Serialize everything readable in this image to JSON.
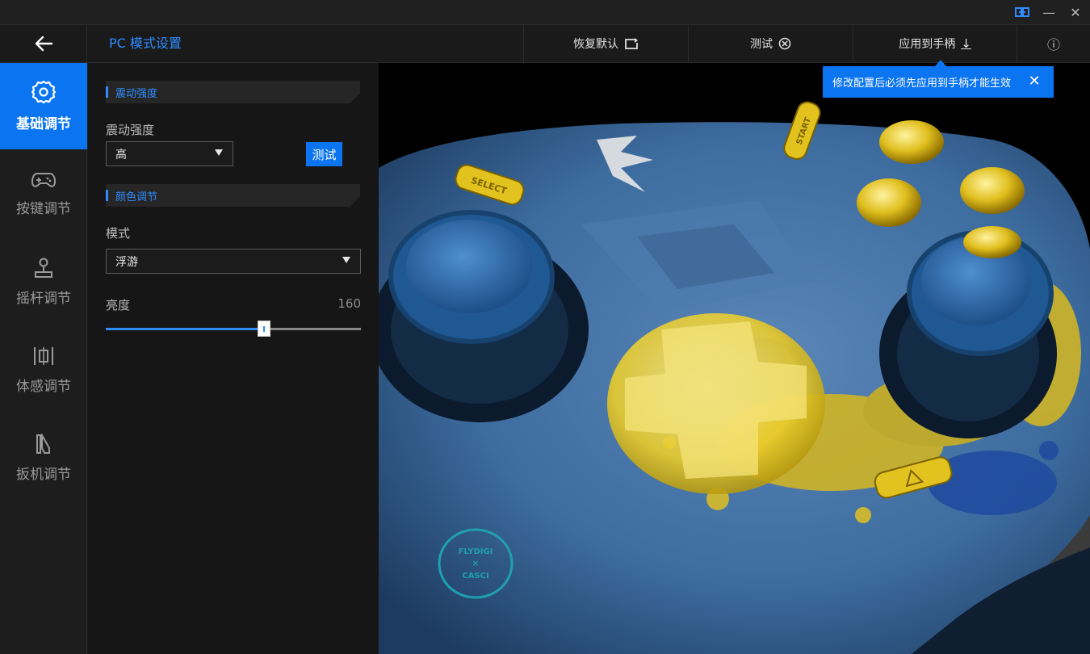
{
  "window": {
    "link_icon": "link-icon",
    "minimize_glyph": "—",
    "close_glyph": "✕"
  },
  "header": {
    "title": "PC 模式设置",
    "restore_label": "恢复默认",
    "test_label": "测试",
    "apply_label": "应用到手柄",
    "apply_arrow": "↓",
    "info_glyph": "ⓘ"
  },
  "sidebar": {
    "items": [
      {
        "label": "基础调节",
        "icon": "gear-icon",
        "active": true
      },
      {
        "label": "按键调节",
        "icon": "gamepad-icon",
        "active": false
      },
      {
        "label": "摇杆调节",
        "icon": "joystick-icon",
        "active": false
      },
      {
        "label": "体感调节",
        "icon": "motion-icon",
        "active": false
      },
      {
        "label": "扳机调节",
        "icon": "trigger-icon",
        "active": false
      }
    ]
  },
  "panel": {
    "vibration": {
      "section_title": "震动强度",
      "field_label": "震动强度",
      "selected": "高",
      "test_button": "测试"
    },
    "color": {
      "section_title": "颜色调节",
      "mode_label": "模式",
      "mode_selected": "浮游",
      "brightness_label": "亮度",
      "brightness_value": "160",
      "brightness_fraction": 0.62
    }
  },
  "tooltip": {
    "text": "修改配置后必须先应用到手柄才能生效",
    "close_glyph": "✕"
  },
  "preview": {
    "select_label": "SELECT",
    "start_label": "START",
    "badge_line1": "FLYDIGI",
    "badge_line2": "×",
    "badge_line3": "CASCI"
  },
  "colors": {
    "accent": "#0b74f0",
    "accent_text": "#2f8cff",
    "shell_blue": "#3d6fa8",
    "button_gold": "#e2c21e",
    "dpad_yellow": "#f0d63a"
  }
}
